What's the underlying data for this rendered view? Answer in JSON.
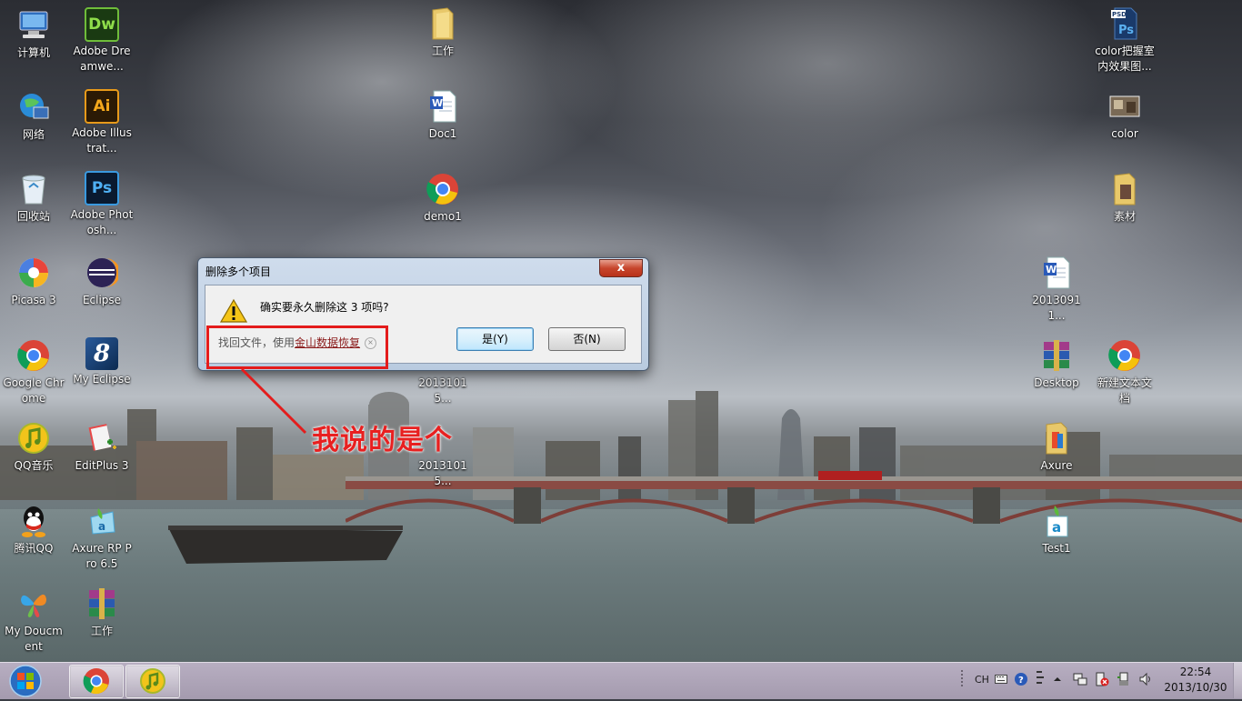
{
  "desktop": {
    "icons": [
      {
        "label": "计算机",
        "icon": "computer-icon"
      },
      {
        "label": "Adobe Dreamwe...",
        "icon": "dreamweaver-icon"
      },
      {
        "label": "网络",
        "icon": "network-icon"
      },
      {
        "label": "Adobe Illustrat...",
        "icon": "illustrator-icon"
      },
      {
        "label": "回收站",
        "icon": "recycle-bin-icon"
      },
      {
        "label": "Adobe Photosh...",
        "icon": "photoshop-icon"
      },
      {
        "label": "Picasa 3",
        "icon": "picasa-icon"
      },
      {
        "label": "Eclipse",
        "icon": "eclipse-icon"
      },
      {
        "label": "Google Chrome",
        "icon": "chrome-icon"
      },
      {
        "label": "My Eclipse",
        "icon": "myeclipse-icon"
      },
      {
        "label": "QQ音乐",
        "icon": "qqmusic-icon"
      },
      {
        "label": "EditPlus 3",
        "icon": "editplus-icon"
      },
      {
        "label": "腾讯QQ",
        "icon": "qq-icon"
      },
      {
        "label": "Axure RP Pro 6.5",
        "icon": "axure-icon"
      },
      {
        "label": "My Doucment",
        "icon": "msn-butterfly-icon"
      },
      {
        "label": "工作",
        "icon": "winrar-icon"
      },
      {
        "label": "工作",
        "icon": "folder-icon"
      },
      {
        "label": "Doc1",
        "icon": "word-doc-icon"
      },
      {
        "label": "demo1",
        "icon": "chrome-icon"
      },
      {
        "label": "20131015...",
        "icon": "file-icon"
      },
      {
        "label": "20131015...",
        "icon": "file-icon"
      },
      {
        "label": "color把握室内效果图...",
        "icon": "psd-file-icon"
      },
      {
        "label": "color",
        "icon": "image-icon"
      },
      {
        "label": "素材",
        "icon": "folder-icon"
      },
      {
        "label": "20130911...",
        "icon": "word-doc-icon"
      },
      {
        "label": "Desktop",
        "icon": "winrar-icon"
      },
      {
        "label": "新建文本文档",
        "icon": "chrome-icon"
      },
      {
        "label": "Axure",
        "icon": "folder-icon"
      },
      {
        "label": "Test1",
        "icon": "axure-file-icon"
      }
    ]
  },
  "dialog": {
    "title": "删除多个项目",
    "close_label": "x",
    "message": "确实要永久删除这 3 项吗?",
    "hint_prefix": "找回文件，使用",
    "hint_link": "金山数据恢复",
    "hint_close": "×",
    "yes_label": "是(Y)",
    "no_label": "否(N)"
  },
  "annotation": {
    "text": "我说的是个"
  },
  "taskbar": {
    "tray_lang": "CH",
    "time": "22:54",
    "date": "2013/10/30"
  },
  "colors": {
    "annotation_red": "#e41c1c",
    "dialog_frame": "#b9cbe0"
  }
}
